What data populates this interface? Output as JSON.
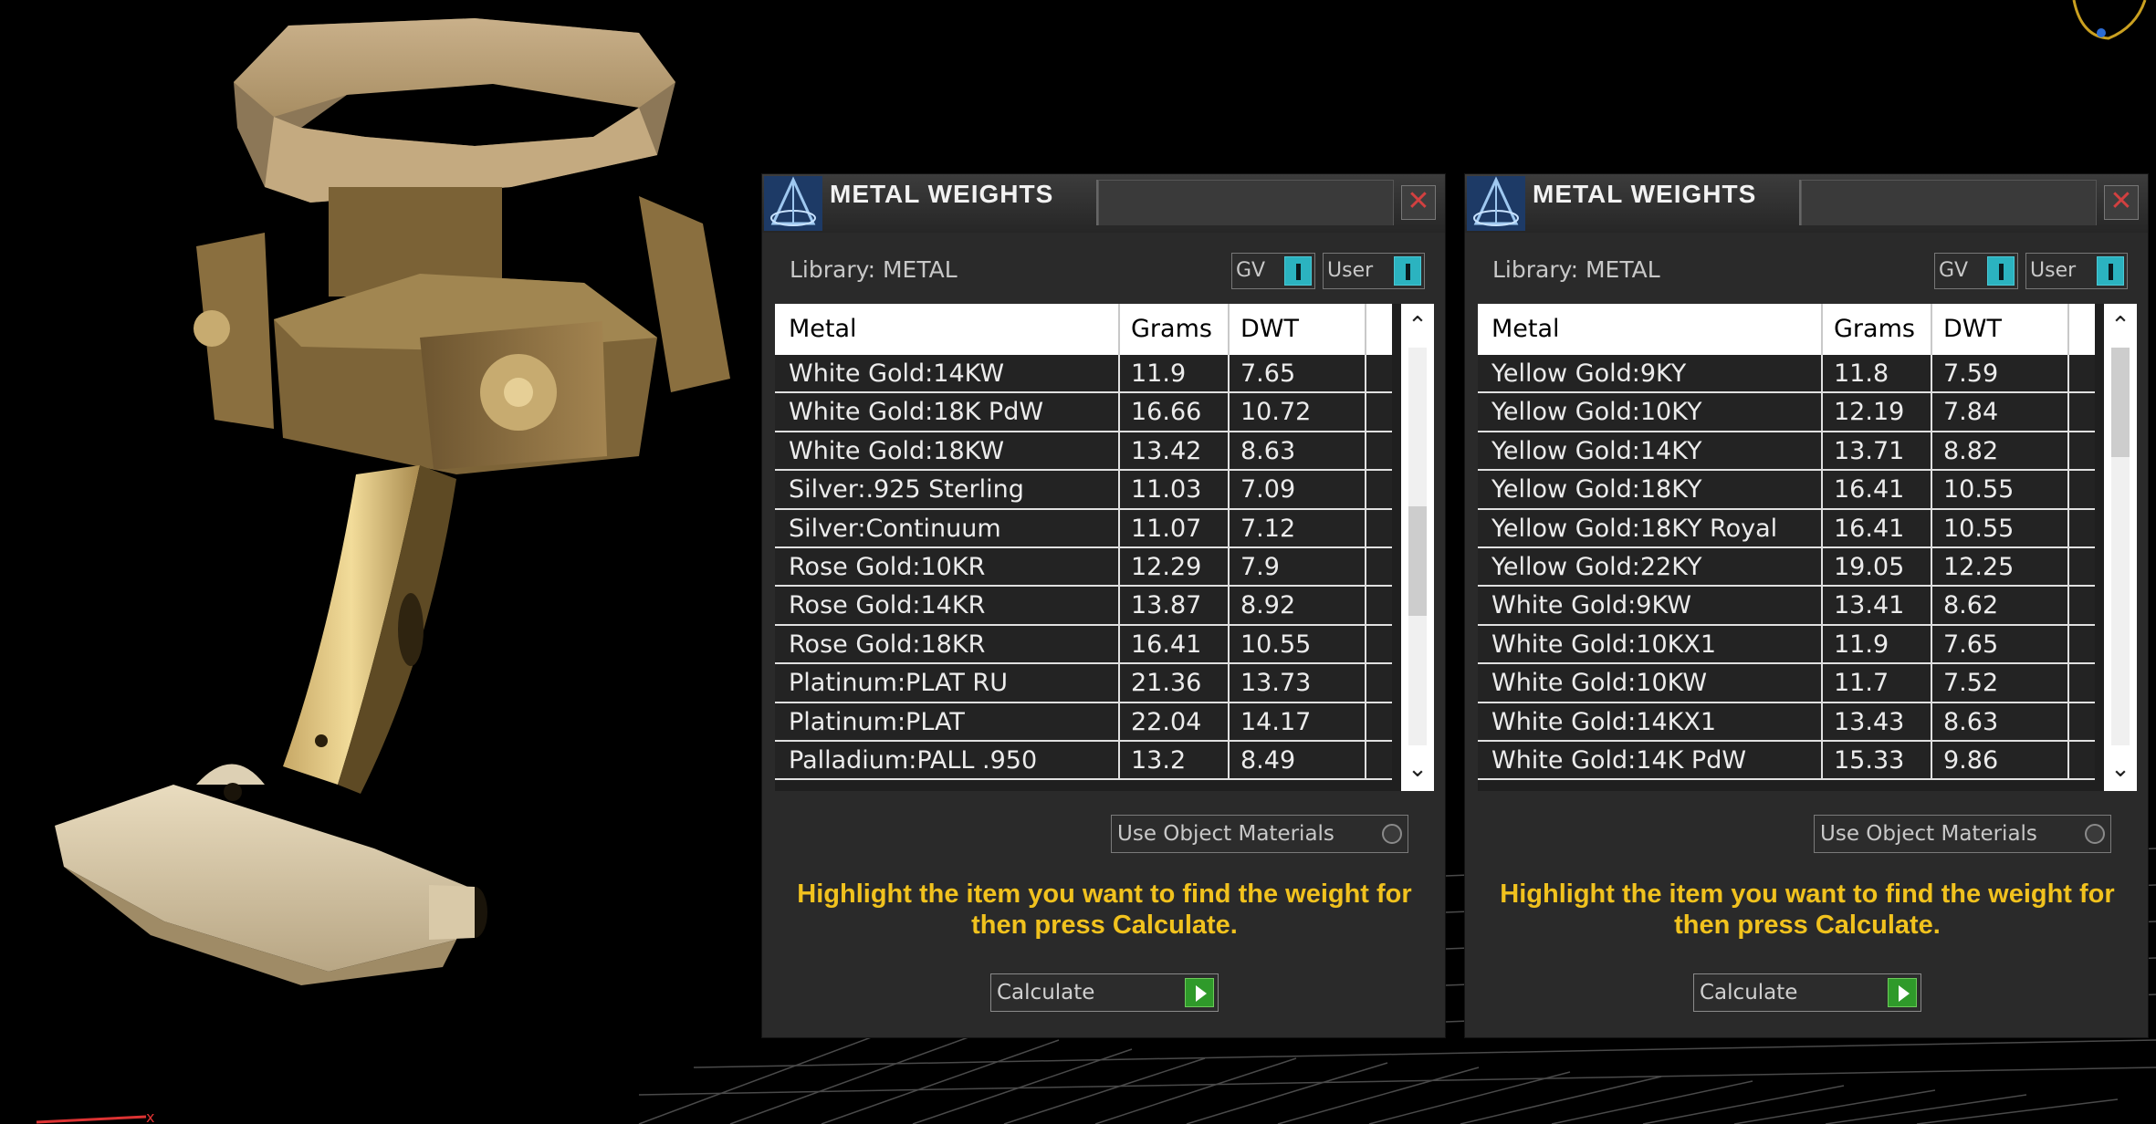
{
  "colors": {
    "panel_bg": "#2a2a2a",
    "hint_text": "#f1c21e",
    "toggle_on": "#2bb3c0",
    "calc_go": "#2f9a2a",
    "close_x": "#d24040",
    "jewelry_gold": "#8a6d3b"
  },
  "panels": [
    {
      "title": "METAL WEIGHTS",
      "library_label": "Library: METAL",
      "toggle_gv": "GV",
      "toggle_user": "User",
      "columns": [
        "Metal",
        "Grams",
        "DWT"
      ],
      "rows": [
        [
          "White Gold:14KW",
          "11.9",
          "7.65"
        ],
        [
          "White Gold:18K PdW",
          "16.66",
          "10.72"
        ],
        [
          "White Gold:18KW",
          "13.42",
          "8.63"
        ],
        [
          "Silver:.925 Sterling",
          "11.03",
          "7.09"
        ],
        [
          "Silver:Continuum",
          "11.07",
          "7.12"
        ],
        [
          "Rose Gold:10KR",
          "12.29",
          "7.9"
        ],
        [
          "Rose Gold:14KR",
          "13.87",
          "8.92"
        ],
        [
          "Rose Gold:18KR",
          "16.41",
          "10.55"
        ],
        [
          "Platinum:PLAT RU",
          "21.36",
          "13.73"
        ],
        [
          "Platinum:PLAT",
          "22.04",
          "14.17"
        ],
        [
          "Palladium:PALL .950",
          "13.2",
          "8.49"
        ]
      ],
      "scroll_position": 0.55,
      "use_object_label": "Use Object Materials",
      "hint": "Highlight the item you want to find the weight for then press Calculate.",
      "calculate_label": "Calculate"
    },
    {
      "title": "METAL WEIGHTS",
      "library_label": "Library: METAL",
      "toggle_gv": "GV",
      "toggle_user": "User",
      "columns": [
        "Metal",
        "Grams",
        "DWT"
      ],
      "rows": [
        [
          "Yellow Gold:9KY",
          "11.8",
          "7.59"
        ],
        [
          "Yellow Gold:10KY",
          "12.19",
          "7.84"
        ],
        [
          "Yellow Gold:14KY",
          "13.71",
          "8.82"
        ],
        [
          "Yellow Gold:18KY",
          "16.41",
          "10.55"
        ],
        [
          "Yellow Gold:18KY Royal",
          "16.41",
          "10.55"
        ],
        [
          "Yellow Gold:22KY",
          "19.05",
          "12.25"
        ],
        [
          "White Gold:9KW",
          "13.41",
          "8.62"
        ],
        [
          "White Gold:10KX1",
          "11.9",
          "7.65"
        ],
        [
          "White Gold:10KW",
          "11.7",
          "7.52"
        ],
        [
          "White Gold:14KX1",
          "13.43",
          "8.63"
        ],
        [
          "White Gold:14K PdW",
          "15.33",
          "9.86"
        ]
      ],
      "scroll_position": 0.0,
      "use_object_label": "Use Object Materials",
      "hint": "Highlight the item you want to find the weight for then press Calculate.",
      "calculate_label": "Calculate"
    }
  ]
}
